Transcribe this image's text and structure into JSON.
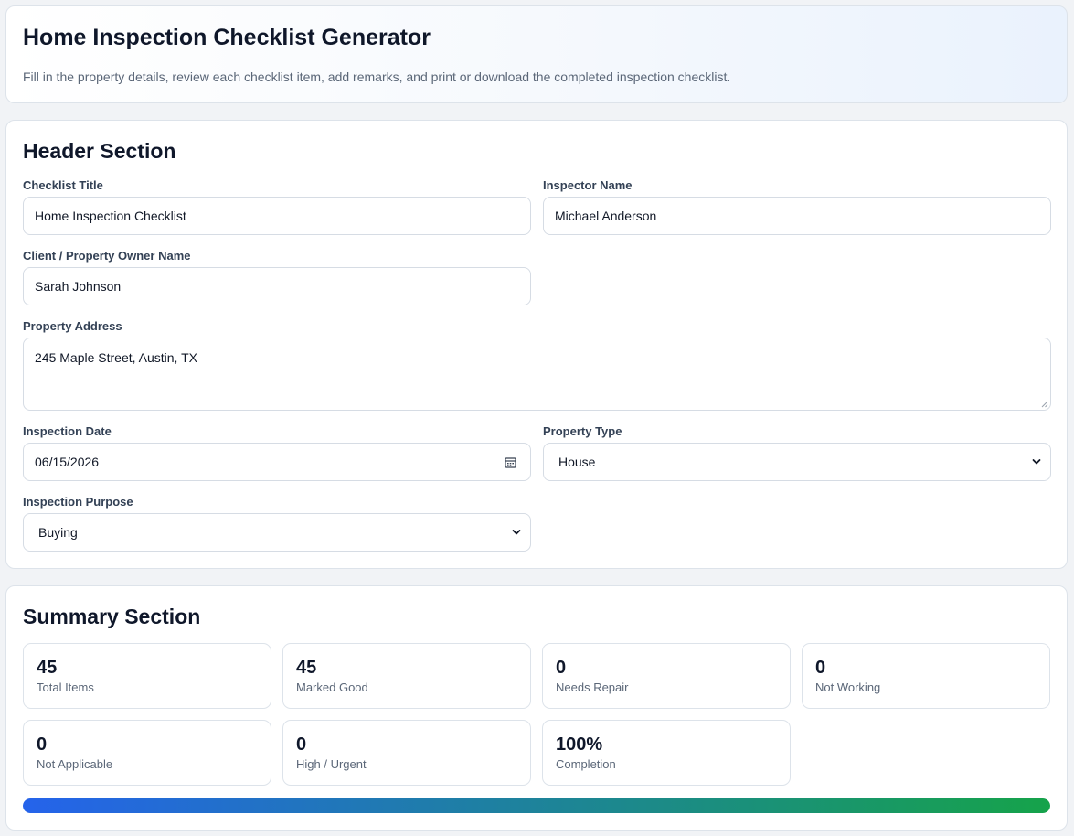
{
  "intro": {
    "title": "Home Inspection Checklist Generator",
    "description": "Fill in the property details, review each checklist item, add remarks, and print or download the completed inspection checklist."
  },
  "header_section": {
    "title": "Header Section",
    "checklist_title": {
      "label": "Checklist Title",
      "value": "Home Inspection Checklist"
    },
    "inspector_name": {
      "label": "Inspector Name",
      "value": "Michael Anderson"
    },
    "client_name": {
      "label": "Client / Property Owner Name",
      "value": "Sarah Johnson"
    },
    "property_address": {
      "label": "Property Address",
      "value": "245 Maple Street, Austin, TX"
    },
    "inspection_date": {
      "label": "Inspection Date",
      "value": "06/15/2026",
      "icon": "calendar-icon"
    },
    "property_type": {
      "label": "Property Type",
      "value": "House",
      "icon": "chevron-down-icon"
    },
    "inspection_purpose": {
      "label": "Inspection Purpose",
      "value": "Buying",
      "icon": "chevron-down-icon"
    }
  },
  "summary_section": {
    "title": "Summary Section",
    "stats": [
      {
        "value": "45",
        "label": "Total Items"
      },
      {
        "value": "45",
        "label": "Marked Good"
      },
      {
        "value": "0",
        "label": "Needs Repair"
      },
      {
        "value": "0",
        "label": "Not Working"
      },
      {
        "value": "0",
        "label": "Not Applicable"
      },
      {
        "value": "0",
        "label": "High / Urgent"
      },
      {
        "value": "100%",
        "label": "Completion"
      }
    ],
    "progress_percent": 100,
    "progress_colors": [
      "#2563eb",
      "#16a34a"
    ]
  }
}
